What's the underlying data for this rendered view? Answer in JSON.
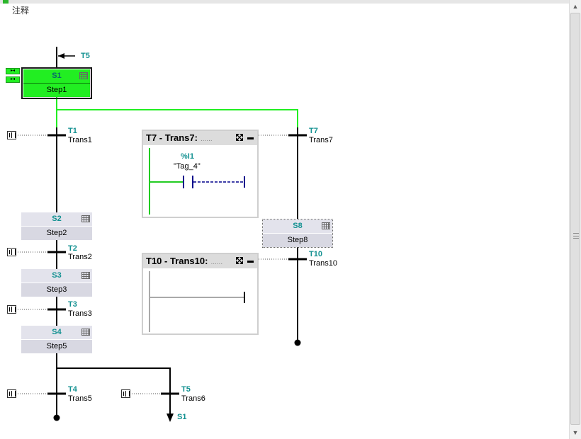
{
  "header": {
    "comment_label": "注释"
  },
  "steps": [
    {
      "id": "S1",
      "name": "Step1",
      "active": true
    },
    {
      "id": "S2",
      "name": "Step2"
    },
    {
      "id": "S3",
      "name": "Step3"
    },
    {
      "id": "S4",
      "name": "Step5"
    },
    {
      "id": "S8",
      "name": "Step8"
    }
  ],
  "transitions": [
    {
      "id": "T5",
      "name": ""
    },
    {
      "id": "T1",
      "name": "Trans1"
    },
    {
      "id": "T7",
      "name": "Trans7"
    },
    {
      "id": "T2",
      "name": "Trans2"
    },
    {
      "id": "T10",
      "name": "Trans10"
    },
    {
      "id": "T3",
      "name": "Trans3"
    },
    {
      "id": "T4",
      "name": "Trans5"
    },
    {
      "id": "T5",
      "name": "Trans6"
    }
  ],
  "jump_target": "S1",
  "panels": {
    "t7": {
      "title": "T7 - Trans7:",
      "dots": "......",
      "contact_address": "%I1",
      "contact_tag": "\"Tag_4\""
    },
    "t10": {
      "title": "T10 - Trans10:",
      "dots": "......"
    }
  },
  "colors": {
    "active_step": "#22ee22",
    "active_flow": "#22ee22",
    "label_teal": "#139191",
    "coil_blue": "#00008b"
  },
  "icons": {
    "scroll_up": "▲",
    "scroll_down": "▼"
  }
}
